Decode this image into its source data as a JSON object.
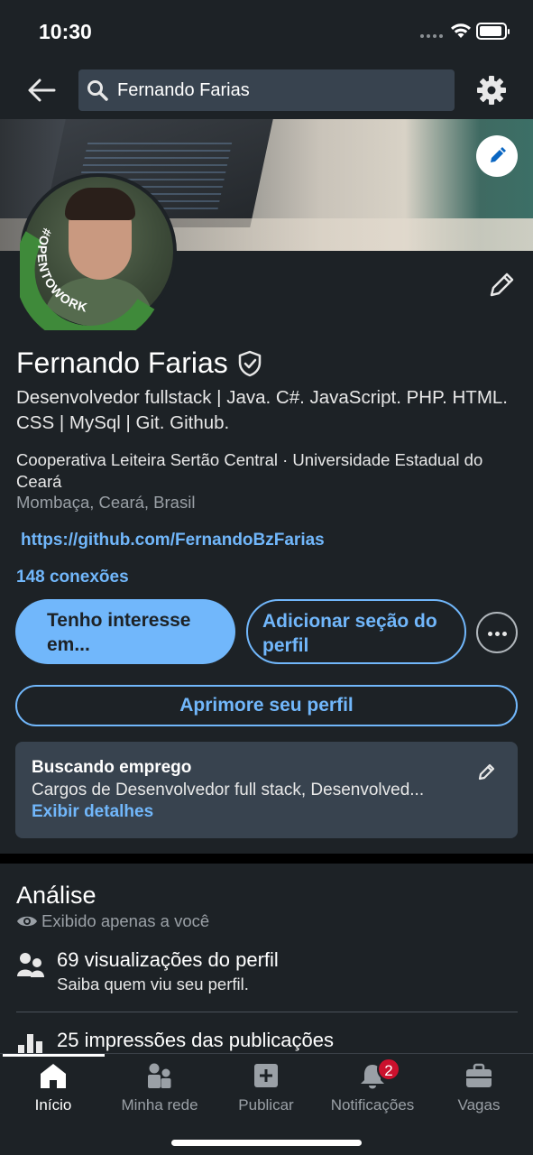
{
  "status_bar": {
    "time": "10:30"
  },
  "search": {
    "value": "Fernando Farias"
  },
  "profile": {
    "open_to_work_badge": "#OPENTOWORK",
    "name": "Fernando Farias",
    "headline": "Desenvolvedor fullstack | Java. C#. JavaScript. PHP. HTML. CSS | MySql | Git. Github.",
    "company": "Cooperativa Leiteira Sertão Central · Universidade Estadual do Ceará",
    "location": "Mombaça, Ceará, Brasil",
    "website": "https://github.com/FernandoBzFarias",
    "connections": "148 conexões"
  },
  "actions": {
    "primary_label": "Tenho interesse em...",
    "secondary_label": "Adicionar seção do perfil",
    "outline_label": "Aprimore seu perfil"
  },
  "open_to_work": {
    "title": "Buscando emprego",
    "description": "Cargos de Desenvolvedor full stack, Desenvolved...",
    "link": "Exibir detalhes"
  },
  "analytics": {
    "title": "Análise",
    "subtitle": "Exibido apenas a você",
    "stats": [
      {
        "title": "69 visualizações do perfil",
        "subtitle": "Saiba quem viu seu perfil."
      },
      {
        "title": "25 impressões das publicações",
        "subtitle": ""
      }
    ]
  },
  "bottom_nav": {
    "items": [
      {
        "label": "Início",
        "icon": "home-icon",
        "active": true
      },
      {
        "label": "Minha rede",
        "icon": "network-icon"
      },
      {
        "label": "Publicar",
        "icon": "post-icon"
      },
      {
        "label": "Notificações",
        "icon": "bell-icon",
        "badge": "2"
      },
      {
        "label": "Vagas",
        "icon": "briefcase-icon"
      }
    ]
  },
  "colors": {
    "background": "#1d2226",
    "accent": "#71b7fb",
    "badge": "#cb112d",
    "open_to_work_green": "#3f8a3a"
  }
}
